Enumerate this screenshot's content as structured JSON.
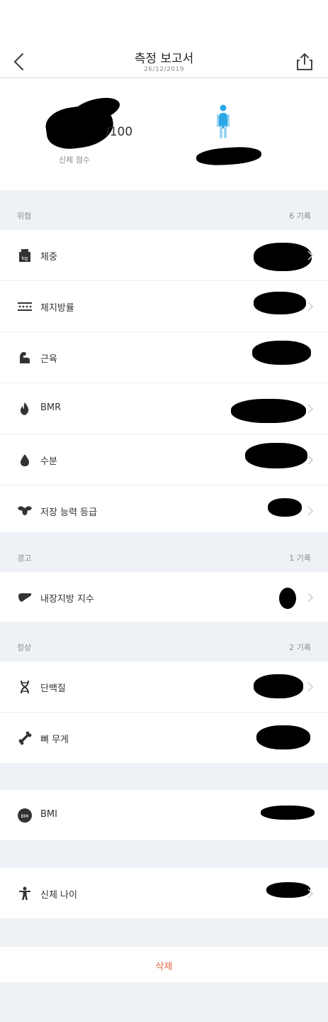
{
  "header": {
    "title": "측정 보고서",
    "date": "26/12/2019"
  },
  "summary": {
    "score_max": "/100",
    "score_label": "신체 점수"
  },
  "sections": {
    "danger": {
      "title": "위험",
      "count": "6 기록",
      "items": [
        {
          "label": "체중",
          "icon": "weight-icon"
        },
        {
          "label": "체지방률",
          "icon": "body-fat-icon"
        },
        {
          "label": "근육",
          "icon": "muscle-icon"
        },
        {
          "label": "BMR",
          "icon": "flame-icon"
        },
        {
          "label": "수분",
          "icon": "water-drop-icon"
        },
        {
          "label": "저장 능력 등급",
          "icon": "muscle-torso-icon"
        }
      ]
    },
    "warning": {
      "title": "경고",
      "count": "1 기록",
      "items": [
        {
          "label": "내장지방 지수",
          "icon": "liver-icon"
        }
      ]
    },
    "normal": {
      "title": "정상",
      "count": "2 기록",
      "items": [
        {
          "label": "단백질",
          "icon": "dna-icon"
        },
        {
          "label": "뼈 무게",
          "icon": "bone-icon"
        }
      ]
    },
    "bmi": {
      "items": [
        {
          "label": "BMI",
          "icon": "bmi-icon"
        }
      ]
    },
    "body_age": {
      "items": [
        {
          "label": "신체 나이",
          "icon": "person-icon"
        }
      ]
    }
  },
  "delete_label": "삭제",
  "colors": {
    "accent_person": "#2aa7e6",
    "delete": "#e0673f",
    "section_bg": "#eef2f6"
  }
}
